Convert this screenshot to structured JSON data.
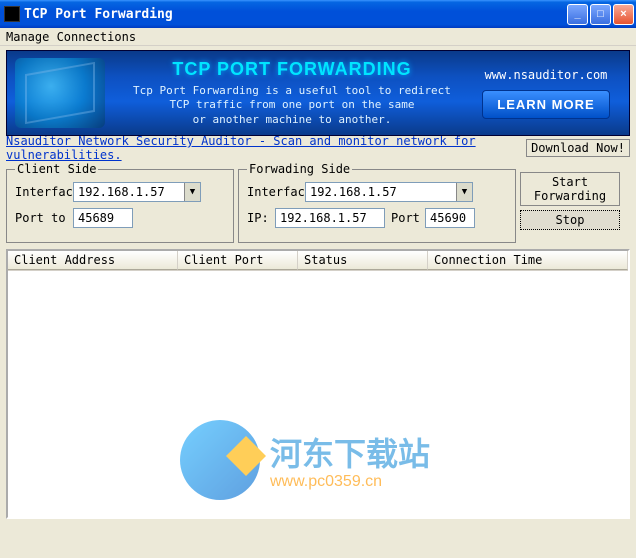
{
  "window": {
    "title": "TCP Port Forwarding"
  },
  "menu": {
    "item1": "Manage Connections"
  },
  "banner": {
    "title": "TCP PORT FORWARDING",
    "subtitle_l1": "Tcp Port Forwarding is a useful tool to redirect",
    "subtitle_l2": "TCP  traffic from one port on the same",
    "subtitle_l3": "or another machine to another.",
    "url": "www.nsauditor.com",
    "learn_more": "LEARN MORE"
  },
  "linkrow": {
    "link_text": "Nsauditor Network Security Auditor - Scan and monitor network for vulnerabilities.",
    "download": "Download Now!"
  },
  "client": {
    "legend": "Client Side",
    "interface_label": "Interfac",
    "interface_value": "192.168.1.57",
    "port_label": "Port to",
    "port_value": "45689"
  },
  "forward": {
    "legend": "Forwading Side",
    "interface_label": "Interfac",
    "interface_value": "192.168.1.57",
    "ip_label": "IP:",
    "ip_value": "192.168.1.57",
    "port_label": "Port",
    "port_value": "45690"
  },
  "buttons": {
    "start": "Start Forwarding",
    "stop": "Stop"
  },
  "list": {
    "col1": "Client Address",
    "col2": "Client Port",
    "col3": "Status",
    "col4": "Connection Time"
  },
  "watermark": {
    "text1": "河东下载站",
    "text2": "www.pc0359.cn"
  }
}
